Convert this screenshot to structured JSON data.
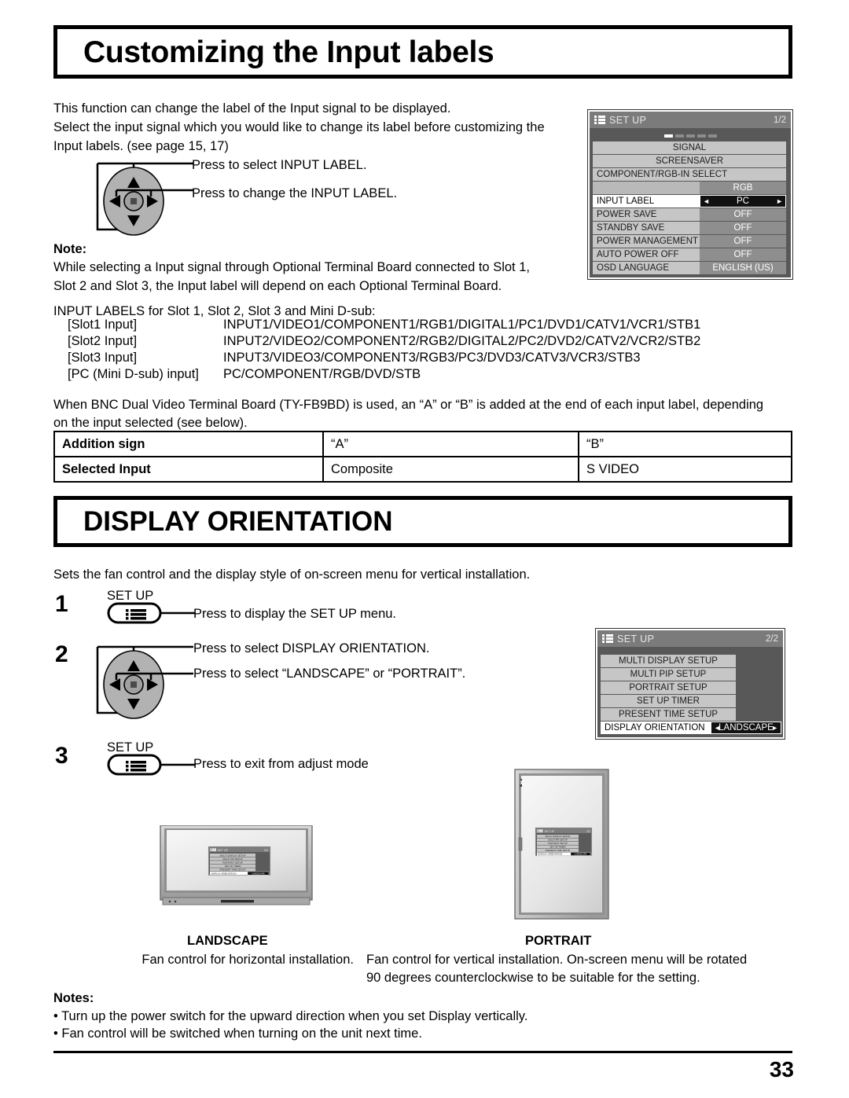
{
  "page": {
    "number": "33"
  },
  "section1": {
    "title": "Customizing the Input labels",
    "intro": "This function can change the label of the Input signal to be displayed.\nSelect the input signal which you would like to change its label before customizing the\nInput labels. (see page 15, 17)",
    "dpad_callout_up": "Press to select INPUT LABEL.",
    "dpad_callout_lr": "Press to change the INPUT LABEL.",
    "note_label": "Note:",
    "note_body": "While selecting a Input signal through Optional Terminal Board connected to Slot 1,\nSlot 2 and Slot 3, the Input label will depend on each Optional Terminal Board.",
    "labels_heading": "INPUT LABELS for Slot 1, Slot 2, Slot 3 and Mini D-sub:",
    "slots": [
      {
        "key": "[Slot1 Input]",
        "value": "INPUT1/VIDEO1/COMPONENT1/RGB1/DIGITAL1/PC1/DVD1/CATV1/VCR1/STB1"
      },
      {
        "key": "[Slot2 Input]",
        "value": "INPUT2/VIDEO2/COMPONENT2/RGB2/DIGITAL2/PC2/DVD2/CATV2/VCR2/STB2"
      },
      {
        "key": "[Slot3 Input]",
        "value": "INPUT3/VIDEO3/COMPONENT3/RGB3/PC3/DVD3/CATV3/VCR3/STB3"
      },
      {
        "key": "[PC (Mini D-sub) input]",
        "value": "PC/COMPONENT/RGB/DVD/STB"
      }
    ],
    "bnc_note": "When BNC Dual Video Terminal Board (TY-FB9BD) is used, an “A” or “B” is added at the end of each input label, depending\non the input selected (see below).",
    "table": {
      "rows": [
        {
          "c0": "Addition sign",
          "c1": "“A”",
          "c2": "“B”"
        },
        {
          "c0": "Selected Input",
          "c1": "Composite",
          "c2": "S VIDEO"
        }
      ]
    }
  },
  "osd1": {
    "title": "SET UP",
    "page": "1/2",
    "dashes": 5,
    "dash_active": 0,
    "rows": [
      {
        "label": "SIGNAL",
        "value": "",
        "style": "full-center"
      },
      {
        "label": "SCREENSAVER",
        "value": "",
        "style": "full-center"
      },
      {
        "label": "COMPONENT/RGB-IN SELECT",
        "value": "",
        "style": "wide"
      },
      {
        "label": "",
        "value": "RGB",
        "style": "blank-value"
      },
      {
        "label": "INPUT LABEL",
        "value": "PC",
        "style": "selected",
        "arrow_left": "◄",
        "arrow_right": "►"
      },
      {
        "label": "POWER SAVE",
        "value": "OFF",
        "style": "normal"
      },
      {
        "label": "STANDBY SAVE",
        "value": "OFF",
        "style": "normal"
      },
      {
        "label": "POWER MANAGEMENT",
        "value": "OFF",
        "style": "normal"
      },
      {
        "label": "AUTO POWER OFF",
        "value": "OFF",
        "style": "normal"
      },
      {
        "label": "OSD LANGUAGE",
        "value": "ENGLISH (US)",
        "style": "normal"
      }
    ]
  },
  "section2": {
    "title": "DISPLAY ORIENTATION",
    "intro": "Sets the fan control and the display style of on-screen menu for vertical installation.",
    "steps": [
      {
        "num": "1",
        "button_label": "SET UP",
        "callout": "Press to display the SET UP menu."
      },
      {
        "num": "2",
        "callout_up": "Press to select DISPLAY ORIENTATION.",
        "callout_lr": "Press to select “LANDSCAPE” or “PORTRAIT”."
      },
      {
        "num": "3",
        "button_label": "SET UP",
        "callout": "Press to exit from adjust mode"
      }
    ],
    "caption_landscape": "LANDSCAPE",
    "caption_portrait": "PORTRAIT",
    "desc_landscape": "Fan control for horizontal installation.",
    "desc_portrait": "Fan control for vertical installation. On-screen menu will be rotated\n90 degrees counterclockwise to be suitable for the setting.",
    "notes_label": "Notes:",
    "notes": [
      "• Turn up the power switch for the upward direction when you set Display vertically.",
      "• Fan control will be switched when turning on the unit next time."
    ]
  },
  "osd2": {
    "title": "SET UP",
    "page": "2/2",
    "rows": [
      {
        "label": "MULTI DISPLAY SETUP",
        "value": "",
        "style": "full-center"
      },
      {
        "label": "MULTI PIP SETUP",
        "value": "",
        "style": "full-center"
      },
      {
        "label": "PORTRAIT SETUP",
        "value": "",
        "style": "full-center"
      },
      {
        "label": "SET UP TIMER",
        "value": "",
        "style": "full-center"
      },
      {
        "label": "PRESENT TIME SETUP",
        "value": "",
        "style": "full-center"
      },
      {
        "label": "DISPLAY ORIENTATION",
        "value": "LANDSCAPE",
        "style": "selected",
        "arrow_left": "◄",
        "arrow_right": "►"
      }
    ]
  },
  "colors": {
    "osd_bg": "#585858",
    "osd_header": "#7b7b7b",
    "osd_label": "#c6c6c6",
    "osd_value": "#8e8e8e",
    "selected_bg": "#111111"
  }
}
